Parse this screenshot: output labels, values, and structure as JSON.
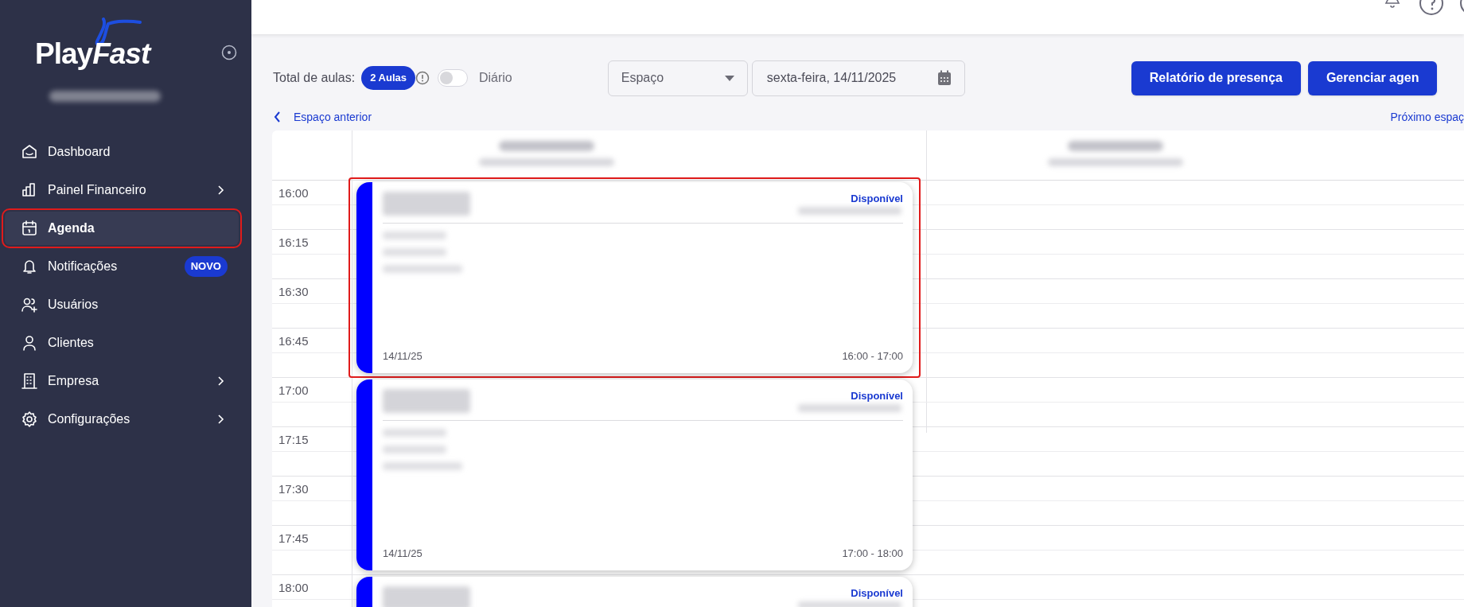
{
  "sidebar": {
    "logo": {
      "text": "Play",
      "accent": "Fast"
    },
    "items": [
      {
        "label": "Dashboard",
        "selected": false,
        "expandable": false,
        "highlighted": false
      },
      {
        "label": "Painel Financeiro",
        "selected": false,
        "expandable": true,
        "highlighted": false
      },
      {
        "label": "Agenda",
        "selected": true,
        "expandable": false,
        "highlighted": true
      },
      {
        "label": "Notificações",
        "selected": false,
        "expandable": false,
        "highlighted": false,
        "badge": "NOVO"
      },
      {
        "label": "Usuários",
        "selected": false,
        "expandable": false,
        "highlighted": false
      },
      {
        "label": "Clientes",
        "selected": false,
        "expandable": false,
        "highlighted": false
      },
      {
        "label": "Empresa",
        "selected": false,
        "expandable": true,
        "highlighted": false
      },
      {
        "label": "Configurações",
        "selected": false,
        "expandable": true,
        "highlighted": false
      }
    ]
  },
  "toolbar": {
    "total_label": "Total de aulas:",
    "total_badge": "2 Aulas",
    "daily_toggle": {
      "label": "Diário",
      "on": false
    },
    "space_select": {
      "placeholder": "Espaço"
    },
    "date_field": {
      "value": "sexta-feira, 14/11/2025"
    },
    "buttons": [
      "Relatório de presença",
      "Gerenciar agen"
    ]
  },
  "navigation": {
    "previous": "Espaço anterior",
    "next": "Próximo espaç"
  },
  "schedule": {
    "times": [
      "16:00",
      "16:15",
      "16:30",
      "16:45",
      "17:00",
      "17:15",
      "17:30",
      "17:45",
      "18:00"
    ],
    "events": [
      {
        "status": "Disponível",
        "date": "14/11/25",
        "time": "16:00 - 17:00",
        "highlighted": true
      },
      {
        "status": "Disponível",
        "date": "14/11/25",
        "time": "17:00 - 18:00",
        "highlighted": false
      },
      {
        "status": "Disponível",
        "highlighted": false
      }
    ]
  }
}
